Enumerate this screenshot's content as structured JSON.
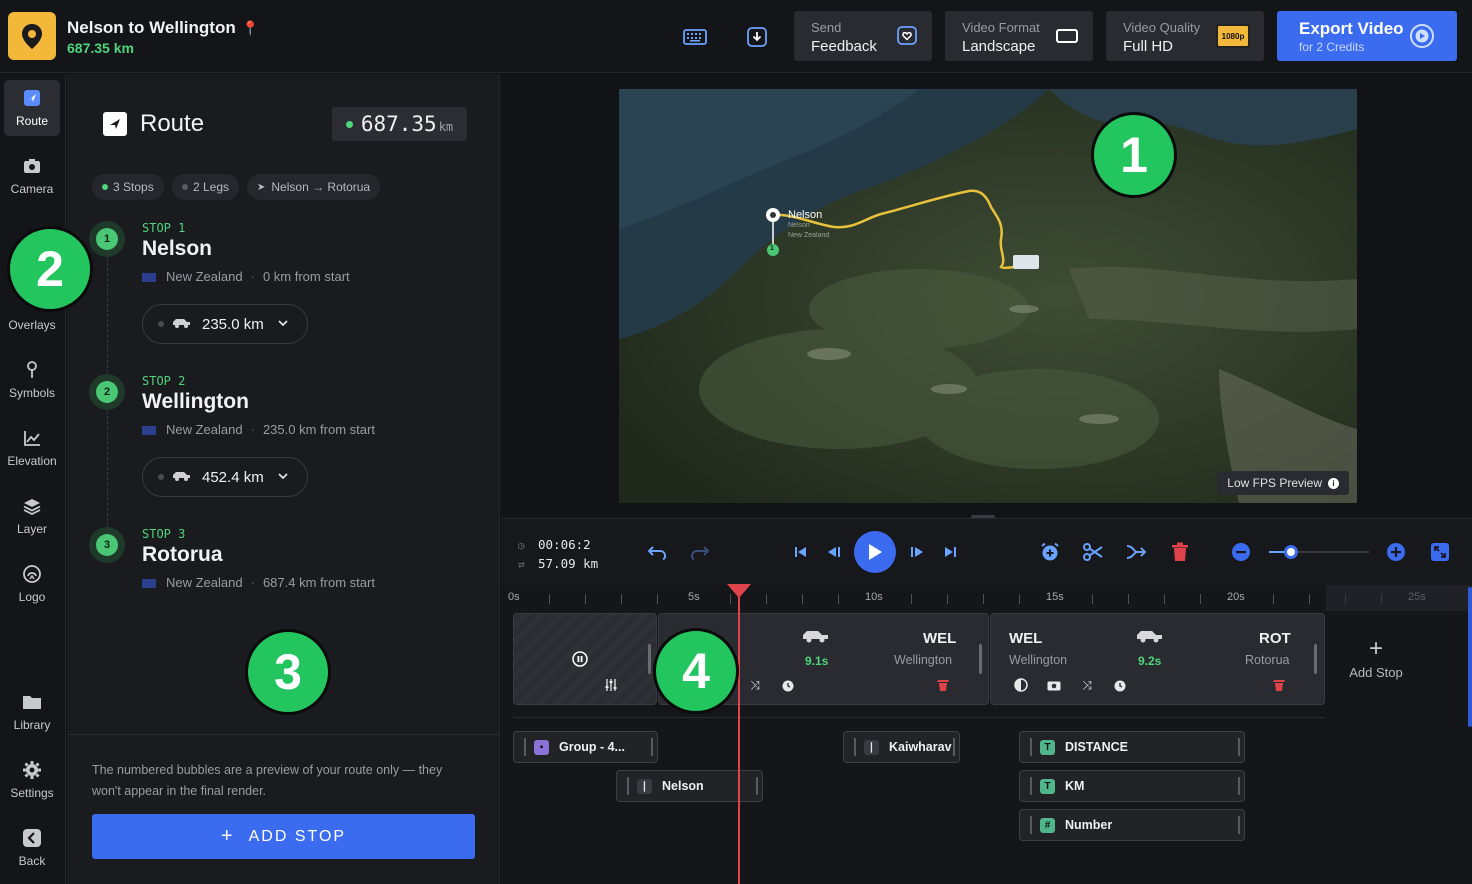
{
  "header": {
    "title": "Nelson to Wellington",
    "distance": "687.35 km",
    "send_feedback": {
      "small": "Send",
      "big": "Feedback"
    },
    "video_format": {
      "small": "Video Format",
      "big": "Landscape"
    },
    "video_quality": {
      "small": "Video Quality",
      "big": "Full HD",
      "badge": "1080p"
    },
    "export": {
      "big": "Export Video",
      "small": "for 2 Credits"
    }
  },
  "rail": {
    "items": [
      {
        "label": "Route",
        "icon": "route-icon"
      },
      {
        "label": "Camera",
        "icon": "camera-icon"
      },
      {
        "label": "Overlays",
        "icon": "overlays-icon"
      },
      {
        "label": "Symbols",
        "icon": "pin-icon"
      },
      {
        "label": "Elevation",
        "icon": "chart-icon"
      },
      {
        "label": "Layer",
        "icon": "layers-icon"
      },
      {
        "label": "Logo",
        "icon": "logo-icon"
      },
      {
        "label": "Library",
        "icon": "folder-icon"
      },
      {
        "label": "Settings",
        "icon": "gear-icon"
      },
      {
        "label": "Back",
        "icon": "back-icon"
      }
    ]
  },
  "route": {
    "title": "Route",
    "distance_value": "687.35",
    "distance_unit": "km",
    "chips": {
      "stops": "3 Stops",
      "legs": "2 Legs",
      "path": "Nelson → Rotorua"
    },
    "stops": [
      {
        "label": "STOP 1",
        "num": "1",
        "name": "Nelson",
        "country": "New Zealand",
        "from_start": "0 km from start"
      },
      {
        "label": "STOP 2",
        "num": "2",
        "name": "Wellington",
        "country": "New Zealand",
        "from_start": "235.0 km from start"
      },
      {
        "label": "STOP 3",
        "num": "3",
        "name": "Rotorua",
        "country": "New Zealand",
        "from_start": "687.4 km from start"
      }
    ],
    "legs": [
      "235.0 km",
      "452.4 km"
    ],
    "note": "The numbered bubbles are a preview of your route only — they won't appear in the final render.",
    "add_stop": "ADD STOP"
  },
  "bubbles": [
    "1",
    "2",
    "3",
    "4"
  ],
  "map": {
    "marker_label": "Nelson",
    "marker_sub1": "Nelson",
    "marker_sub2": "New Zealand",
    "marker_num": "1",
    "fps_label": "Low FPS Preview"
  },
  "controls": {
    "time": "00:06:2",
    "distance": "57.09 km",
    "zoom_fraction": 0.22
  },
  "timeline": {
    "ticks": [
      "0s",
      "5s",
      "10s",
      "15s",
      "20s",
      "25s"
    ],
    "segments": [
      {
        "code_from": "",
        "code_to": "WEL",
        "place_to": "Wellington",
        "duration": "9.1s"
      },
      {
        "code_from": "WEL",
        "place_from": "Wellington",
        "code_to": "ROT",
        "place_to": "Rotorua",
        "duration": "9.2s"
      }
    ],
    "add_stop": "Add Stop",
    "tags": [
      {
        "label": "Group - 4...",
        "icon": "group-icon"
      },
      {
        "label": "Nelson",
        "icon": "pin-icon"
      },
      {
        "label": "Kaiwharav",
        "icon": "pin-icon"
      },
      {
        "label": "DISTANCE",
        "icon": "text-icon"
      },
      {
        "label": "KM",
        "icon": "text-icon"
      },
      {
        "label": "Number",
        "icon": "hash-icon"
      }
    ]
  },
  "colors": {
    "accent": "#3b6cf0",
    "green": "#22c55e",
    "playhead": "#e0434a"
  }
}
